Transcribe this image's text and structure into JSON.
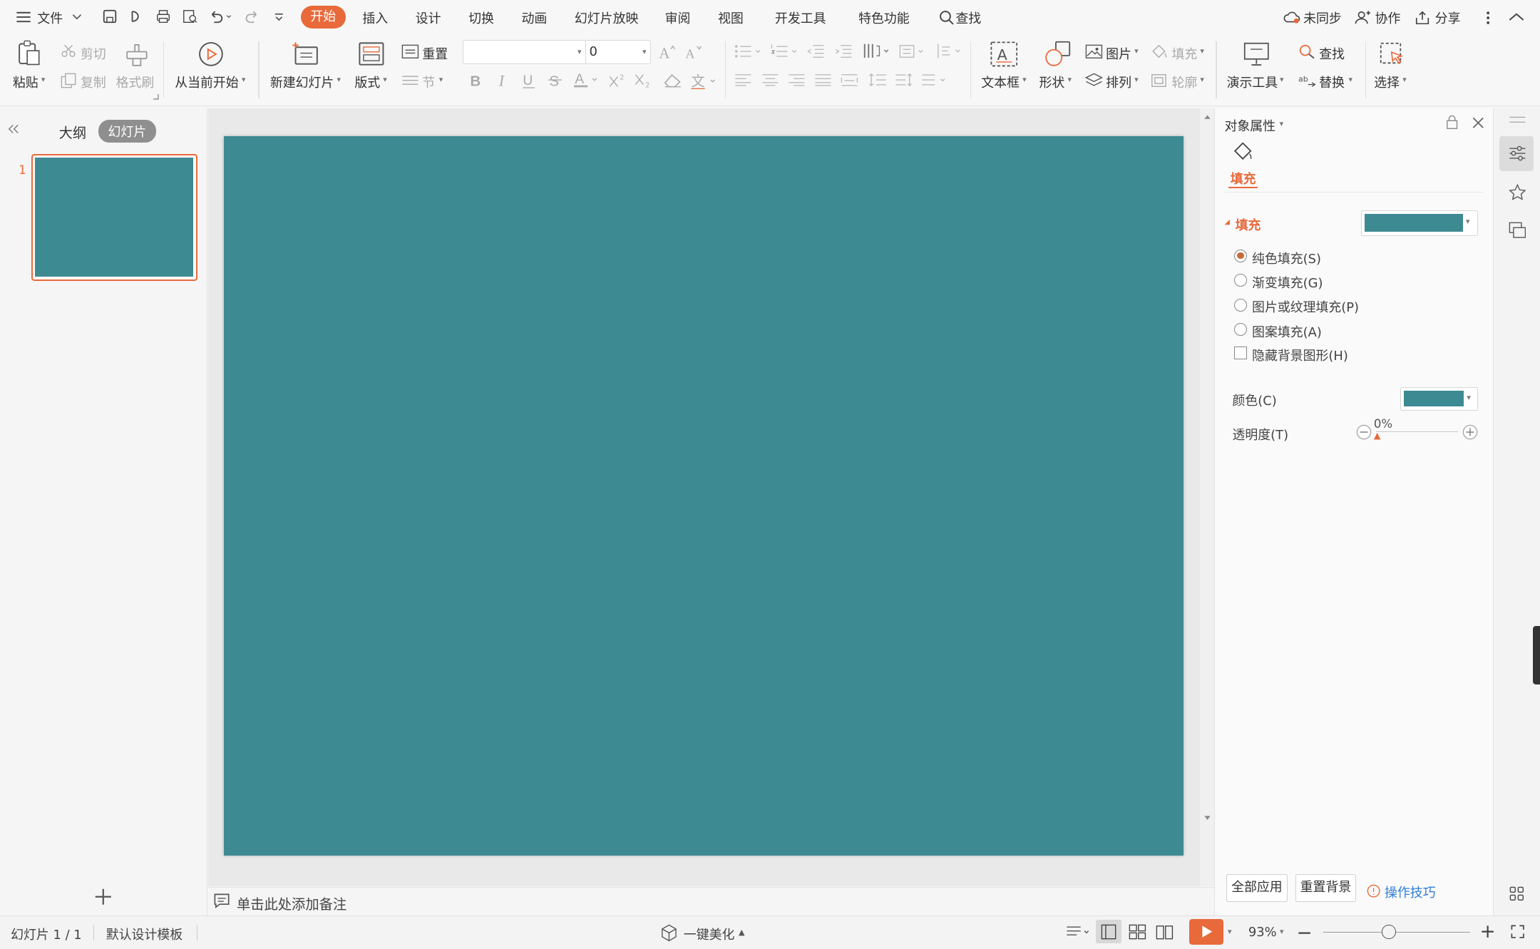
{
  "colors": {
    "accent": "#e8693a",
    "slide_fill": "#3d8a92",
    "fill_label": "#e8693a"
  },
  "topbar": {
    "file_label": "文件",
    "tabs": [
      "开始",
      "插入",
      "设计",
      "切换",
      "动画",
      "幻灯片放映",
      "审阅",
      "视图",
      "开发工具",
      "特色功能"
    ],
    "search_label": "查找",
    "sync_label": "未同步",
    "collab_label": "协作",
    "share_label": "分享"
  },
  "ribbon": {
    "paste": "粘贴",
    "cut": "剪切",
    "copy": "复制",
    "format_painter": "格式刷",
    "from_current": "从当前开始",
    "new_slide": "新建幻灯片",
    "layout": "版式",
    "reset": "重置",
    "section": "节",
    "font_size_value": "0",
    "textbox": "文本框",
    "shape": "形状",
    "picture": "图片",
    "fill": "填充",
    "arrange": "排列",
    "outline": "轮廓",
    "presentation_tools": "演示工具",
    "find": "查找",
    "replace": "替换",
    "select": "选择"
  },
  "left_panel": {
    "tab_outline": "大纲",
    "tab_slides": "幻灯片",
    "slide_number": "1"
  },
  "notes": {
    "placeholder": "单击此处添加备注"
  },
  "right_panel": {
    "title": "对象属性",
    "tab_fill": "填充",
    "section_fill": "填充",
    "options": [
      "纯色填充(S)",
      "渐变填充(G)",
      "图片或纹理填充(P)",
      "图案填充(A)"
    ],
    "selected_option": "纯色填充(S)",
    "hide_bg": "隐藏背景图形(H)",
    "color_label": "颜色(C)",
    "transparency_label": "透明度(T)",
    "transparency_value": "0%",
    "apply_all": "全部应用",
    "reset_bg": "重置背景",
    "tips": "操作技巧"
  },
  "status": {
    "slide_info": "幻灯片 1 / 1",
    "template": "默认设计模板",
    "beautify": "一键美化",
    "zoom": "93%"
  }
}
